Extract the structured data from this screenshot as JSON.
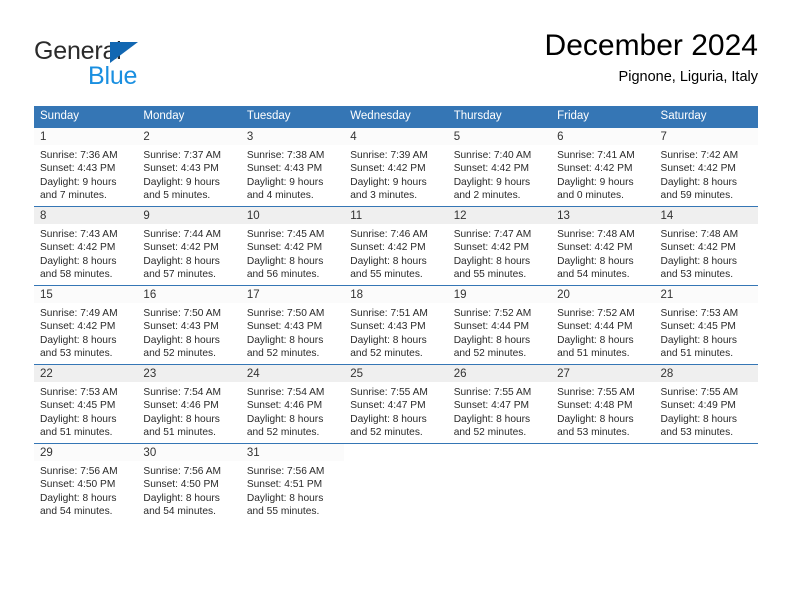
{
  "brand": {
    "name_part1": "General",
    "name_part2": "Blue",
    "logo_icon": "triangle-logo-icon"
  },
  "header": {
    "month_title": "December 2024",
    "location": "Pignone, Liguria, Italy"
  },
  "calendar": {
    "weekday_headers": [
      "Sunday",
      "Monday",
      "Tuesday",
      "Wednesday",
      "Thursday",
      "Friday",
      "Saturday"
    ],
    "header_bg": "#3576b5",
    "row_shade": "#efefef",
    "weeks": [
      {
        "shaded": false,
        "days": [
          {
            "num": "1",
            "sunrise": "Sunrise: 7:36 AM",
            "sunset": "Sunset: 4:43 PM",
            "daylight_line1": "Daylight: 9 hours",
            "daylight_line2": "and 7 minutes."
          },
          {
            "num": "2",
            "sunrise": "Sunrise: 7:37 AM",
            "sunset": "Sunset: 4:43 PM",
            "daylight_line1": "Daylight: 9 hours",
            "daylight_line2": "and 5 minutes."
          },
          {
            "num": "3",
            "sunrise": "Sunrise: 7:38 AM",
            "sunset": "Sunset: 4:43 PM",
            "daylight_line1": "Daylight: 9 hours",
            "daylight_line2": "and 4 minutes."
          },
          {
            "num": "4",
            "sunrise": "Sunrise: 7:39 AM",
            "sunset": "Sunset: 4:42 PM",
            "daylight_line1": "Daylight: 9 hours",
            "daylight_line2": "and 3 minutes."
          },
          {
            "num": "5",
            "sunrise": "Sunrise: 7:40 AM",
            "sunset": "Sunset: 4:42 PM",
            "daylight_line1": "Daylight: 9 hours",
            "daylight_line2": "and 2 minutes."
          },
          {
            "num": "6",
            "sunrise": "Sunrise: 7:41 AM",
            "sunset": "Sunset: 4:42 PM",
            "daylight_line1": "Daylight: 9 hours",
            "daylight_line2": "and 0 minutes."
          },
          {
            "num": "7",
            "sunrise": "Sunrise: 7:42 AM",
            "sunset": "Sunset: 4:42 PM",
            "daylight_line1": "Daylight: 8 hours",
            "daylight_line2": "and 59 minutes."
          }
        ]
      },
      {
        "shaded": true,
        "days": [
          {
            "num": "8",
            "sunrise": "Sunrise: 7:43 AM",
            "sunset": "Sunset: 4:42 PM",
            "daylight_line1": "Daylight: 8 hours",
            "daylight_line2": "and 58 minutes."
          },
          {
            "num": "9",
            "sunrise": "Sunrise: 7:44 AM",
            "sunset": "Sunset: 4:42 PM",
            "daylight_line1": "Daylight: 8 hours",
            "daylight_line2": "and 57 minutes."
          },
          {
            "num": "10",
            "sunrise": "Sunrise: 7:45 AM",
            "sunset": "Sunset: 4:42 PM",
            "daylight_line1": "Daylight: 8 hours",
            "daylight_line2": "and 56 minutes."
          },
          {
            "num": "11",
            "sunrise": "Sunrise: 7:46 AM",
            "sunset": "Sunset: 4:42 PM",
            "daylight_line1": "Daylight: 8 hours",
            "daylight_line2": "and 55 minutes."
          },
          {
            "num": "12",
            "sunrise": "Sunrise: 7:47 AM",
            "sunset": "Sunset: 4:42 PM",
            "daylight_line1": "Daylight: 8 hours",
            "daylight_line2": "and 55 minutes."
          },
          {
            "num": "13",
            "sunrise": "Sunrise: 7:48 AM",
            "sunset": "Sunset: 4:42 PM",
            "daylight_line1": "Daylight: 8 hours",
            "daylight_line2": "and 54 minutes."
          },
          {
            "num": "14",
            "sunrise": "Sunrise: 7:48 AM",
            "sunset": "Sunset: 4:42 PM",
            "daylight_line1": "Daylight: 8 hours",
            "daylight_line2": "and 53 minutes."
          }
        ]
      },
      {
        "shaded": false,
        "days": [
          {
            "num": "15",
            "sunrise": "Sunrise: 7:49 AM",
            "sunset": "Sunset: 4:42 PM",
            "daylight_line1": "Daylight: 8 hours",
            "daylight_line2": "and 53 minutes."
          },
          {
            "num": "16",
            "sunrise": "Sunrise: 7:50 AM",
            "sunset": "Sunset: 4:43 PM",
            "daylight_line1": "Daylight: 8 hours",
            "daylight_line2": "and 52 minutes."
          },
          {
            "num": "17",
            "sunrise": "Sunrise: 7:50 AM",
            "sunset": "Sunset: 4:43 PM",
            "daylight_line1": "Daylight: 8 hours",
            "daylight_line2": "and 52 minutes."
          },
          {
            "num": "18",
            "sunrise": "Sunrise: 7:51 AM",
            "sunset": "Sunset: 4:43 PM",
            "daylight_line1": "Daylight: 8 hours",
            "daylight_line2": "and 52 minutes."
          },
          {
            "num": "19",
            "sunrise": "Sunrise: 7:52 AM",
            "sunset": "Sunset: 4:44 PM",
            "daylight_line1": "Daylight: 8 hours",
            "daylight_line2": "and 52 minutes."
          },
          {
            "num": "20",
            "sunrise": "Sunrise: 7:52 AM",
            "sunset": "Sunset: 4:44 PM",
            "daylight_line1": "Daylight: 8 hours",
            "daylight_line2": "and 51 minutes."
          },
          {
            "num": "21",
            "sunrise": "Sunrise: 7:53 AM",
            "sunset": "Sunset: 4:45 PM",
            "daylight_line1": "Daylight: 8 hours",
            "daylight_line2": "and 51 minutes."
          }
        ]
      },
      {
        "shaded": true,
        "days": [
          {
            "num": "22",
            "sunrise": "Sunrise: 7:53 AM",
            "sunset": "Sunset: 4:45 PM",
            "daylight_line1": "Daylight: 8 hours",
            "daylight_line2": "and 51 minutes."
          },
          {
            "num": "23",
            "sunrise": "Sunrise: 7:54 AM",
            "sunset": "Sunset: 4:46 PM",
            "daylight_line1": "Daylight: 8 hours",
            "daylight_line2": "and 51 minutes."
          },
          {
            "num": "24",
            "sunrise": "Sunrise: 7:54 AM",
            "sunset": "Sunset: 4:46 PM",
            "daylight_line1": "Daylight: 8 hours",
            "daylight_line2": "and 52 minutes."
          },
          {
            "num": "25",
            "sunrise": "Sunrise: 7:55 AM",
            "sunset": "Sunset: 4:47 PM",
            "daylight_line1": "Daylight: 8 hours",
            "daylight_line2": "and 52 minutes."
          },
          {
            "num": "26",
            "sunrise": "Sunrise: 7:55 AM",
            "sunset": "Sunset: 4:47 PM",
            "daylight_line1": "Daylight: 8 hours",
            "daylight_line2": "and 52 minutes."
          },
          {
            "num": "27",
            "sunrise": "Sunrise: 7:55 AM",
            "sunset": "Sunset: 4:48 PM",
            "daylight_line1": "Daylight: 8 hours",
            "daylight_line2": "and 53 minutes."
          },
          {
            "num": "28",
            "sunrise": "Sunrise: 7:55 AM",
            "sunset": "Sunset: 4:49 PM",
            "daylight_line1": "Daylight: 8 hours",
            "daylight_line2": "and 53 minutes."
          }
        ]
      },
      {
        "shaded": false,
        "days": [
          {
            "num": "29",
            "sunrise": "Sunrise: 7:56 AM",
            "sunset": "Sunset: 4:50 PM",
            "daylight_line1": "Daylight: 8 hours",
            "daylight_line2": "and 54 minutes."
          },
          {
            "num": "30",
            "sunrise": "Sunrise: 7:56 AM",
            "sunset": "Sunset: 4:50 PM",
            "daylight_line1": "Daylight: 8 hours",
            "daylight_line2": "and 54 minutes."
          },
          {
            "num": "31",
            "sunrise": "Sunrise: 7:56 AM",
            "sunset": "Sunset: 4:51 PM",
            "daylight_line1": "Daylight: 8 hours",
            "daylight_line2": "and 55 minutes."
          },
          {
            "num": "",
            "sunrise": "",
            "sunset": "",
            "daylight_line1": "",
            "daylight_line2": ""
          },
          {
            "num": "",
            "sunrise": "",
            "sunset": "",
            "daylight_line1": "",
            "daylight_line2": ""
          },
          {
            "num": "",
            "sunrise": "",
            "sunset": "",
            "daylight_line1": "",
            "daylight_line2": ""
          },
          {
            "num": "",
            "sunrise": "",
            "sunset": "",
            "daylight_line1": "",
            "daylight_line2": ""
          }
        ]
      }
    ]
  }
}
